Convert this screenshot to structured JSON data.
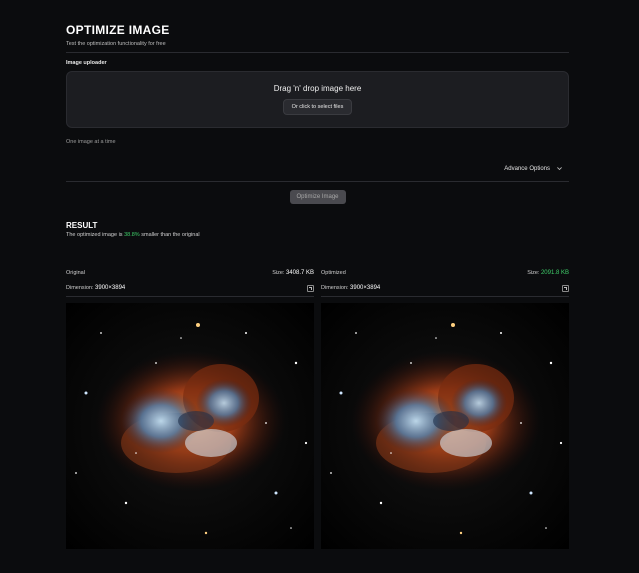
{
  "header": {
    "title": "OPTIMIZE IMAGE",
    "subtitle": "Test the optimization functionality for free"
  },
  "uploader": {
    "label": "Image uploader",
    "drop_text": "Drag 'n' drop image here",
    "select_button": "Or click to select files",
    "helper": "One image at a time"
  },
  "options": {
    "advance_label": "Advance Options"
  },
  "actions": {
    "optimize_label": "Optimize Image"
  },
  "result": {
    "title": "RESULT",
    "text_prefix": "The optimized image is ",
    "percent": "38.8%",
    "text_suffix": " smaller than the original"
  },
  "original": {
    "label": "Original",
    "size_label": "Size:",
    "size_value": "3408.7 KB",
    "dimension_label": "Dimension:",
    "dimension_value": "3900×3894"
  },
  "optimized": {
    "label": "Optimized",
    "size_label": "Size:",
    "size_value": "2091.8 KB",
    "dimension_label": "Dimension:",
    "dimension_value": "3900×3894"
  },
  "colors": {
    "accent_green": "#3fcf6a",
    "background": "#0b0c0e",
    "dropzone": "#1c1d21",
    "button_disabled": "#4a4a4f"
  },
  "icons": {
    "advance": "chevron-down-icon",
    "expand": "expand-icon"
  }
}
